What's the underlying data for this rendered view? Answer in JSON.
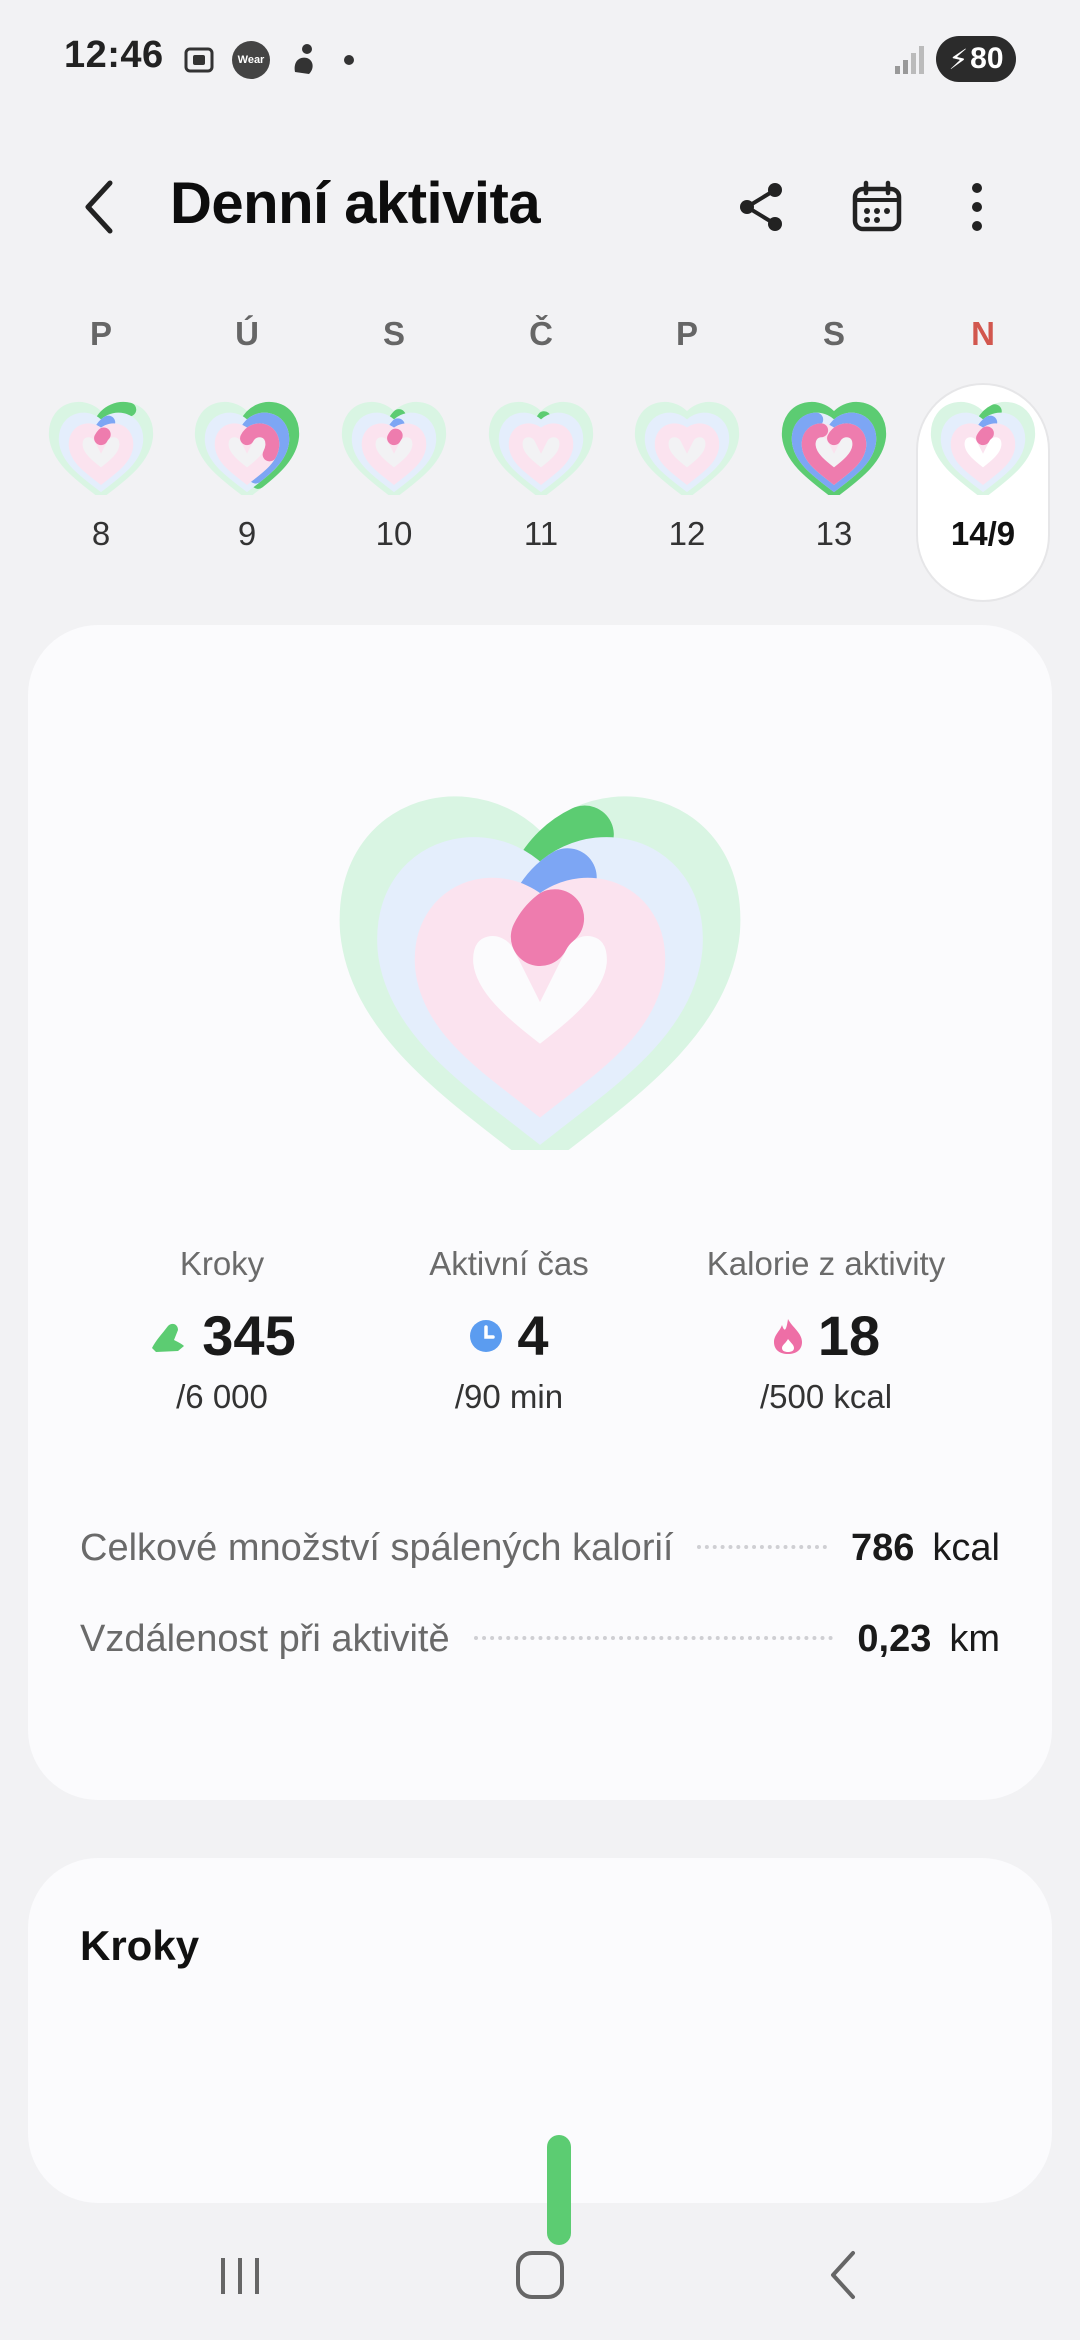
{
  "status_bar": {
    "time": "12:46",
    "wear_label": "Wear",
    "battery": "80",
    "icons": [
      "screenshot-icon",
      "wear-app-icon",
      "fitness-icon",
      "notification-dot-icon",
      "signal-icon",
      "battery-charging-icon"
    ]
  },
  "header": {
    "title": "Denní aktivita",
    "icons": [
      "back-icon",
      "share-icon",
      "calendar-icon",
      "more-icon"
    ]
  },
  "week": {
    "days": [
      {
        "letter": "P",
        "number": "8",
        "steps": 0.12,
        "active": 0.05,
        "calories": 0.03
      },
      {
        "letter": "Ú",
        "number": "9",
        "steps": 0.45,
        "active": 0.45,
        "calories": 0.3
      },
      {
        "letter": "S",
        "number": "10",
        "steps": 0.03,
        "active": 0.03,
        "calories": 0.02
      },
      {
        "letter": "Č",
        "number": "11",
        "steps": 0.02,
        "active": 0.0,
        "calories": 0.0
      },
      {
        "letter": "P",
        "number": "12",
        "steps": 0.0,
        "active": 0.0,
        "calories": 0.0
      },
      {
        "letter": "S",
        "number": "13",
        "steps": 1.0,
        "active": 0.9,
        "calories": 0.9
      },
      {
        "letter": "N",
        "number": "14/9",
        "selected": true,
        "steps": 0.06,
        "active": 0.05,
        "calories": 0.04
      }
    ]
  },
  "summary": {
    "steps_progress": 0.06,
    "active_progress": 0.05,
    "calories_progress": 0.04,
    "stats": [
      {
        "label": "Kroky",
        "value": "345",
        "goal": "/6 000",
        "icon": "steps-shoe-icon",
        "color": "#5ccc72"
      },
      {
        "label": "Aktivní čas",
        "value": "4",
        "goal": "/90 min",
        "icon": "clock-icon",
        "color": "#5b9cf0"
      },
      {
        "label": "Kalorie z aktivity",
        "value": "18",
        "goal": "/500 kcal",
        "icon": "flame-icon",
        "color": "#ee6ea6"
      }
    ],
    "details": [
      {
        "label": "Celkové množství spálených kalorií",
        "value": "786",
        "unit": "kcal"
      },
      {
        "label": "Vzdálenost při aktivitě",
        "value": "0,23",
        "unit": "km"
      }
    ]
  },
  "steps_card": {
    "title": "Kroky"
  },
  "colors": {
    "steps": "#5ccc72",
    "active": "#7da6f4",
    "calories": "#ee7cae",
    "steps_track": "#d9f5e3",
    "active_track": "#e4eefc",
    "calories_track": "#fbe3ef",
    "sunday": "#d2574e"
  },
  "nav": {
    "icons": [
      "recent-apps-icon",
      "home-icon",
      "nav-back-icon"
    ]
  }
}
